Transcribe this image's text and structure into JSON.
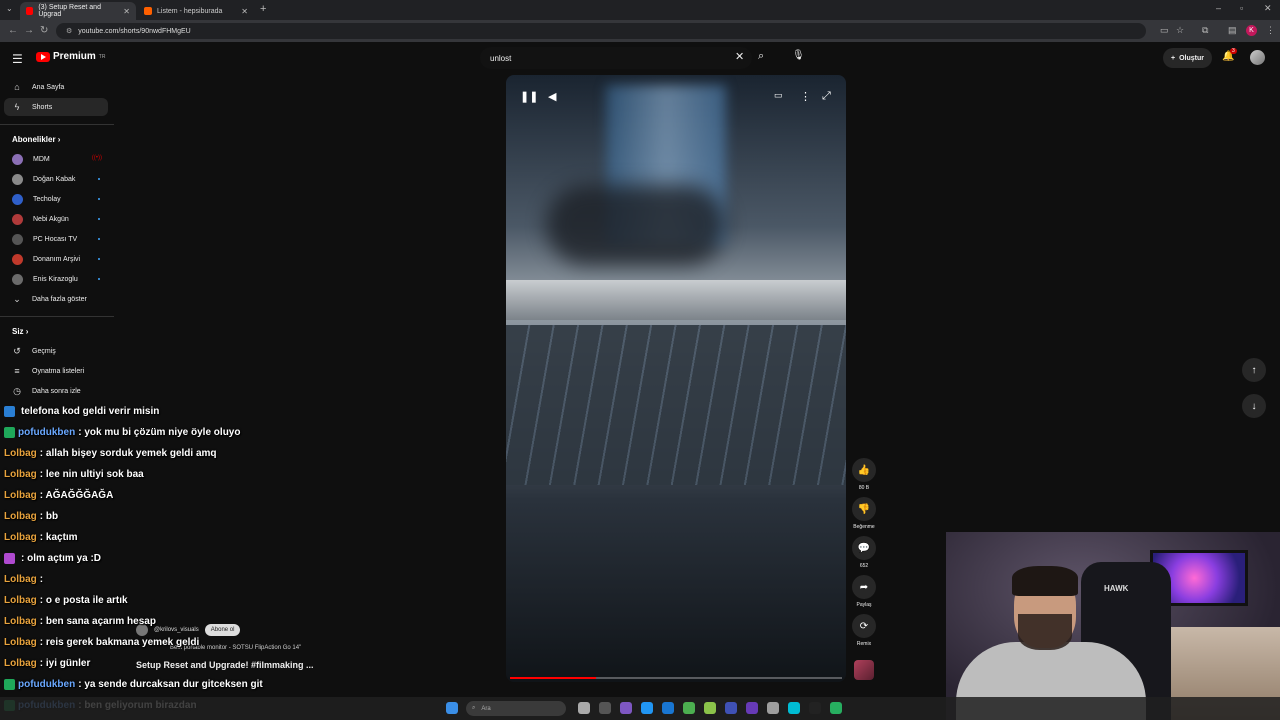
{
  "browser": {
    "tabs": [
      {
        "title": "(3) Setup Reset and Upgrad",
        "active": true,
        "favicon_color": "#ff0000"
      },
      {
        "title": "Listem - hepsiburada",
        "active": false,
        "favicon_color": "#ff6000"
      }
    ],
    "url": "youtube.com/shorts/90nwdFHMgEU"
  },
  "youtube": {
    "logo_text": "Premium",
    "logo_sup": "TR",
    "search_query": "unlost",
    "create_label": "Oluştur",
    "notification_count": "3"
  },
  "sidebar": {
    "main": [
      {
        "label": "Ana Sayfa",
        "icon": "home-icon"
      },
      {
        "label": "Shorts",
        "icon": "shorts-icon",
        "active": true
      }
    ],
    "subscriptions_heading": "Abonelikler",
    "subscriptions": [
      {
        "label": "MDM",
        "color": "#8b6fb5",
        "live": true
      },
      {
        "label": "Doğan Kabak",
        "color": "#8a8a8a"
      },
      {
        "label": "Techolay",
        "color": "#2f5fc9"
      },
      {
        "label": "Nebi Akgün",
        "color": "#b03a3a"
      },
      {
        "label": "PC Hocası TV",
        "color": "#555555"
      },
      {
        "label": "Donanım Arşivi",
        "color": "#c0392b"
      },
      {
        "label": "Enis Kirazoglu",
        "color": "#6b6b6b"
      }
    ],
    "show_more": "Daha fazla göster",
    "you_heading": "Siz",
    "you_items": [
      {
        "label": "Geçmiş",
        "icon": "history-icon"
      },
      {
        "label": "Oynatma listeleri",
        "icon": "playlist-icon"
      },
      {
        "label": "Daha sonra izle",
        "icon": "clock-icon"
      }
    ]
  },
  "short": {
    "progress_fraction": 0.26,
    "channel": "@krilovs_visuals",
    "subscribe_label": "Abone ol",
    "product_text": "Best portable monitor - SOTSU FlipAction Go 14\"",
    "title": "Setup Reset and Upgrade! #filmmaking ...",
    "actions": [
      {
        "icon": "like-icon",
        "label": "80 B"
      },
      {
        "icon": "dislike-icon",
        "label": "Beğenme"
      },
      {
        "icon": "comment-icon",
        "label": "652"
      },
      {
        "icon": "share-icon",
        "label": "Paylaş"
      },
      {
        "icon": "remix-icon",
        "label": "Remix"
      }
    ]
  },
  "chat": [
    {
      "user": "",
      "text": "telefona kod geldi verir misin",
      "user_color": "#ff4444",
      "badge_color": "#2a7fd4"
    },
    {
      "user": "pofudukben",
      "text": ": yok mu bi çözüm niye öyle oluyo",
      "user_color": "#6aa8ff",
      "badge_color": "#1fa85a"
    },
    {
      "user": "Lolbag",
      "text": ": allah bişey sorduk yemek geldi amq",
      "user_color": "#e8a33d",
      "badge_color": ""
    },
    {
      "user": "Lolbag",
      "text": ": lee nin ultiyi sok baa",
      "user_color": "#e8a33d",
      "badge_color": ""
    },
    {
      "user": "Lolbag",
      "text": ": AĞAĞĞĞAĞA",
      "user_color": "#e8a33d",
      "badge_color": ""
    },
    {
      "user": "Lolbag",
      "text": ": bb",
      "user_color": "#e8a33d",
      "badge_color": ""
    },
    {
      "user": "Lolbag",
      "text": ": kaçtım",
      "user_color": "#e8a33d",
      "badge_color": ""
    },
    {
      "user": "",
      "text": ": olm açtım ya :D",
      "user_color": "#ff4444",
      "badge_color": "#b04ad0"
    },
    {
      "user": "Lolbag",
      "text": ":",
      "user_color": "#e8a33d",
      "badge_color": ""
    },
    {
      "user": "Lolbag",
      "text": ": o e posta ile artık",
      "user_color": "#e8a33d",
      "badge_color": ""
    },
    {
      "user": "Lolbag",
      "text": ": ben sana açarım hesap",
      "user_color": "#e8a33d",
      "badge_color": ""
    },
    {
      "user": "Lolbag",
      "text": ": reis gerek bakmana yemek geldi",
      "user_color": "#e8a33d",
      "badge_color": ""
    },
    {
      "user": "Lolbag",
      "text": ": iyi günler",
      "user_color": "#e8a33d",
      "badge_color": ""
    },
    {
      "user": "pofudukben",
      "text": ": ya sende durcaksan dur gitceksen git",
      "user_color": "#6aa8ff",
      "badge_color": "#1fa85a"
    },
    {
      "user": "pofudukben",
      "text": ": ben geliyorum birazdan",
      "user_color": "#6aa8ff",
      "badge_color": "#1fa85a"
    }
  ],
  "webcam": {
    "chair_brand": "HAWK"
  },
  "taskbar": {
    "search_placeholder": "Ara",
    "apps": [
      "#3a8ee6",
      "#aaaaaa",
      "#555555",
      "#7e57c2",
      "#2196f3",
      "#1976d2",
      "#4caf50",
      "#8bc34a",
      "#3f51b5",
      "#673ab7",
      "#9e9e9e",
      "#00bcd4",
      "#222222",
      "#27ae60"
    ]
  }
}
